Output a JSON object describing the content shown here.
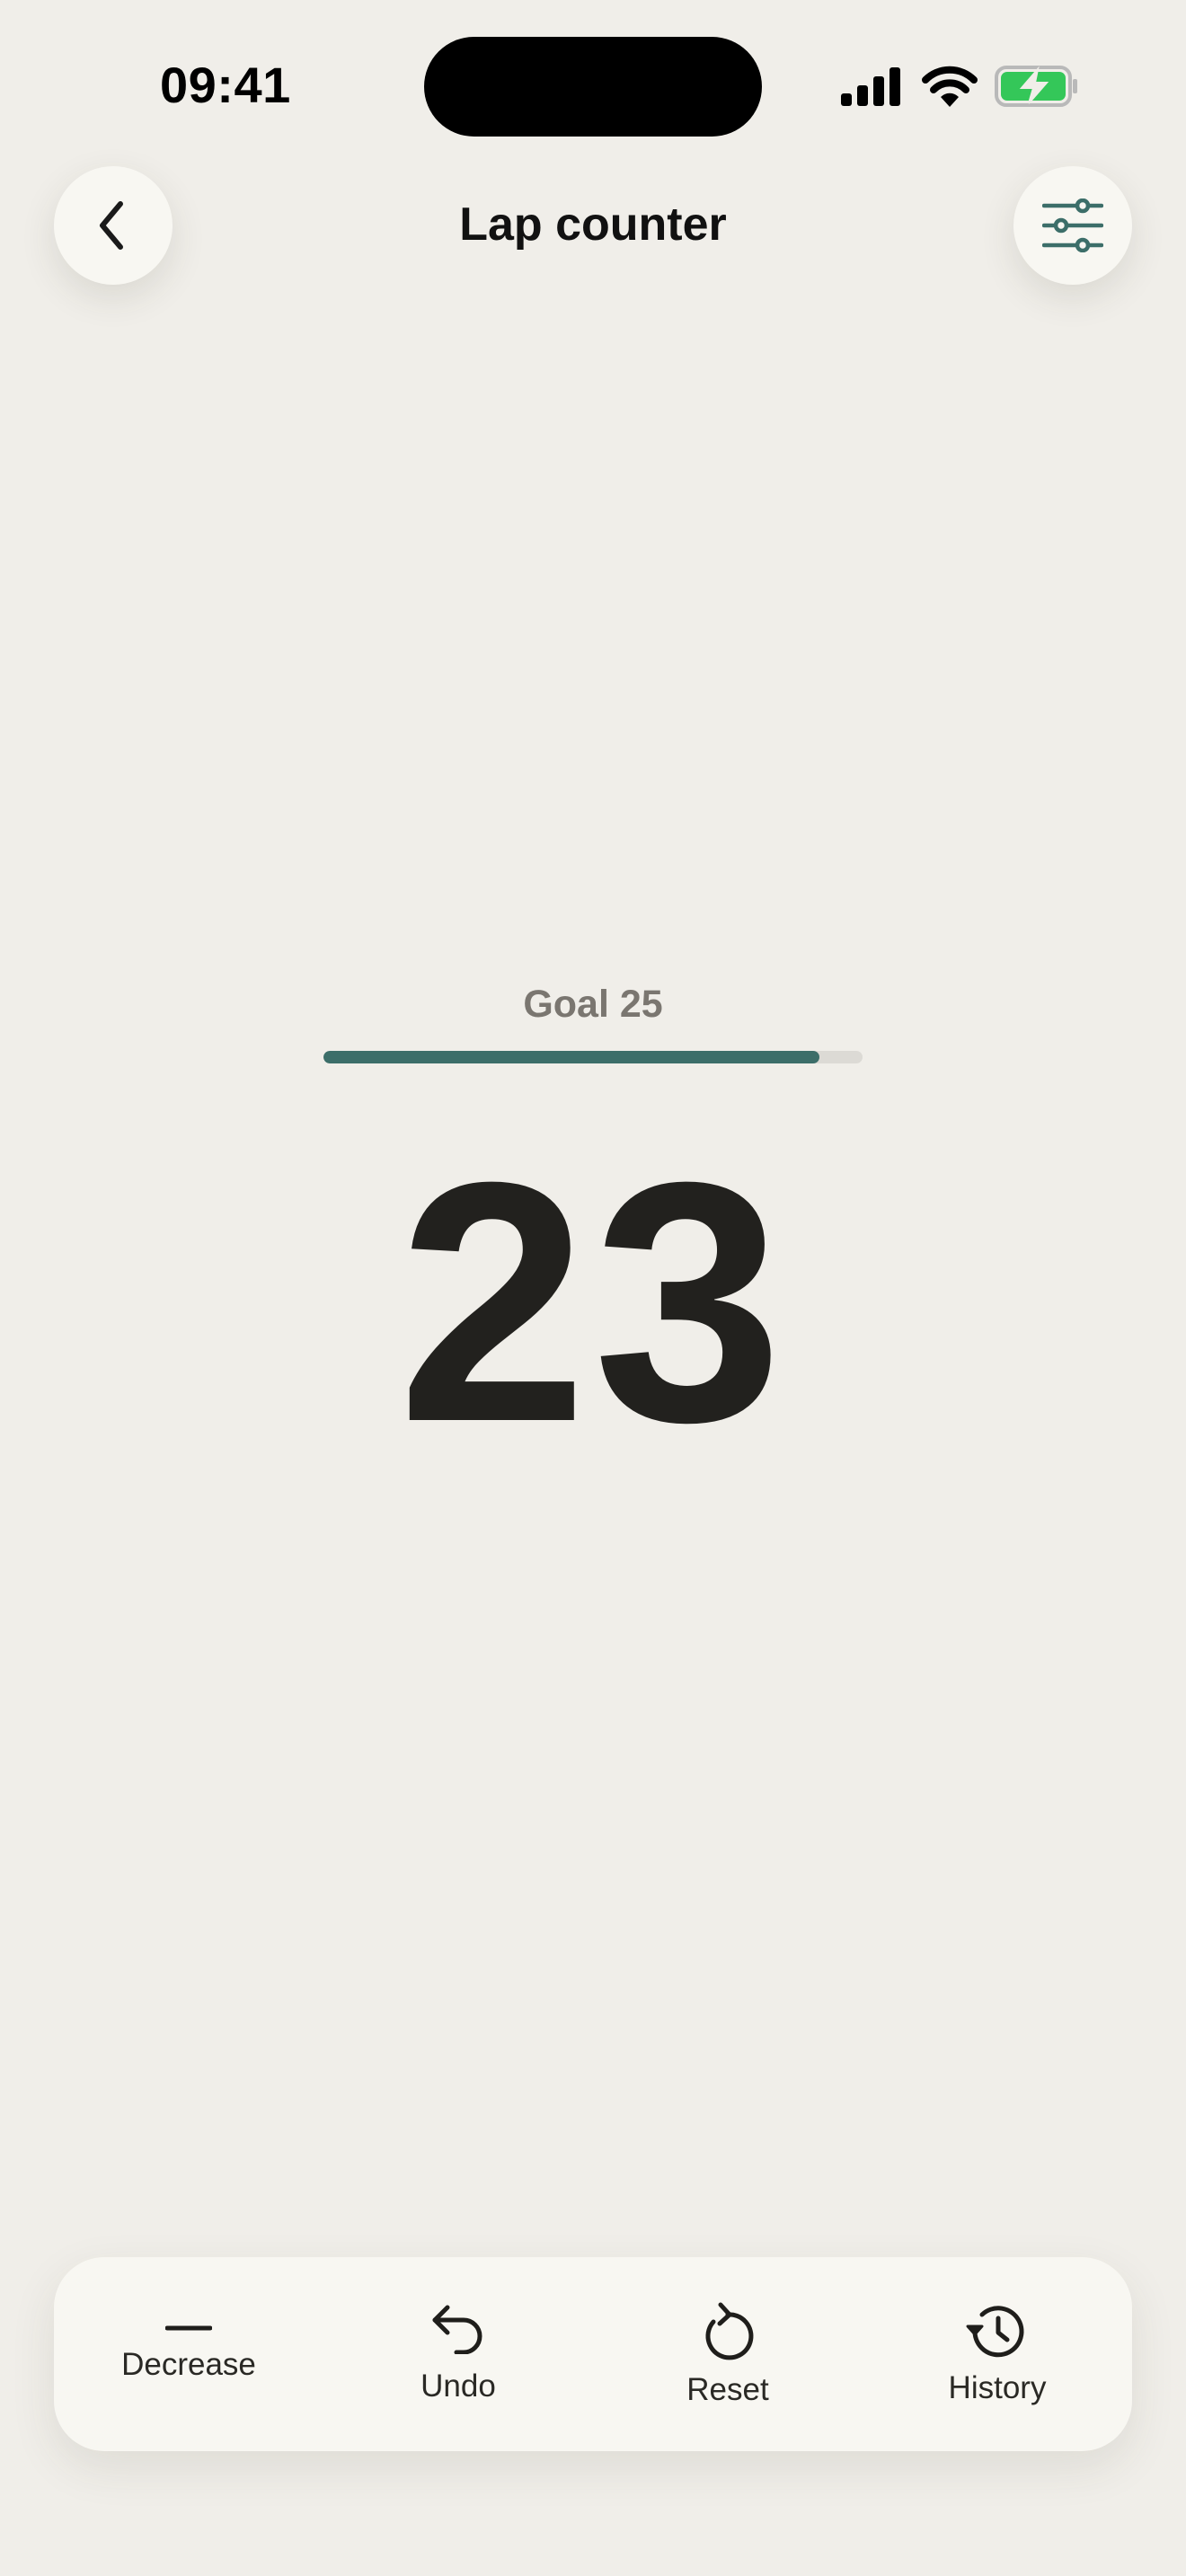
{
  "status_bar": {
    "time": "09:41"
  },
  "header": {
    "title": "Lap counter",
    "back_icon": "chevron-left-icon",
    "settings_icon": "sliders-icon"
  },
  "goal": {
    "label": "Goal 25",
    "progress_fraction": 0.92
  },
  "counter": {
    "value": "23"
  },
  "actions": [
    {
      "label": "Decrease",
      "icon": "minus-icon"
    },
    {
      "label": "Undo",
      "icon": "undo-icon"
    },
    {
      "label": "Reset",
      "icon": "reset-icon"
    },
    {
      "label": "History",
      "icon": "history-icon"
    }
  ],
  "colors": {
    "background": "#f0eee9",
    "accent": "#3c6e69",
    "battery": "#34c759"
  }
}
